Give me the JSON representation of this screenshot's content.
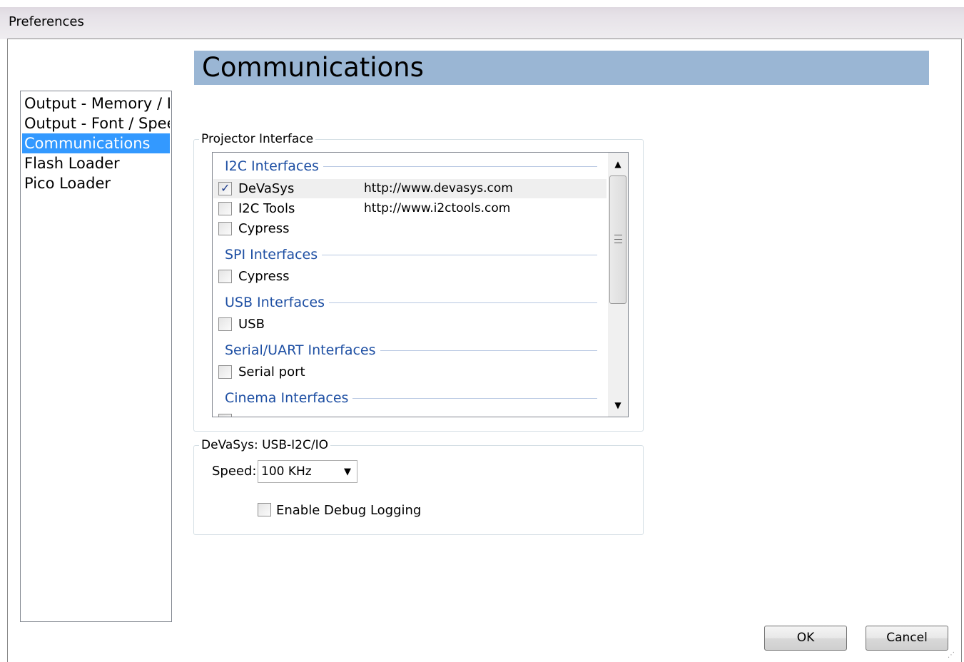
{
  "window": {
    "title": "Preferences"
  },
  "nav": {
    "items": [
      {
        "label": "Output - Memory / Lo"
      },
      {
        "label": "Output - Font / Speed"
      },
      {
        "label": "Communications",
        "selected": true
      },
      {
        "label": "Flash Loader"
      },
      {
        "label": "Pico Loader"
      }
    ]
  },
  "header": {
    "title": "Communications"
  },
  "projector": {
    "group_label": "Projector Interface",
    "sections": {
      "i2c": "I2C Interfaces",
      "spi": "SPI Interfaces",
      "usb": "USB Interfaces",
      "serial": "Serial/UART Interfaces",
      "cinema": "Cinema Interfaces"
    },
    "rows": {
      "devasys": {
        "name": "DeVaSys",
        "url": "http://www.devasys.com",
        "checked": true
      },
      "i2ctools": {
        "name": "I2C Tools",
        "url": "http://www.i2ctools.com",
        "checked": false
      },
      "cypress_i2c": {
        "name": "Cypress",
        "checked": false
      },
      "cypress_spi": {
        "name": "Cypress",
        "checked": false
      },
      "usb": {
        "name": "USB",
        "checked": false
      },
      "serial": {
        "name": "Serial port",
        "checked": false
      }
    },
    "check_glyph": "✓"
  },
  "device": {
    "group_label": "DeVaSys: USB-I2C/IO",
    "speed_label": "Speed:",
    "speed_value": "100 KHz",
    "debug_label": "Enable Debug Logging",
    "debug_checked": false
  },
  "buttons": {
    "ok": "OK",
    "cancel": "Cancel"
  },
  "icons": {
    "scroll_up": "scroll-up-arrow-icon",
    "scroll_down": "scroll-down-arrow-icon",
    "dropdown": "chevron-down-icon",
    "resize": "resize-grip-icon"
  },
  "colors": {
    "header_bg": "#9ab6d4",
    "selection": "#3399ff",
    "section_text": "#1e4fa3"
  }
}
